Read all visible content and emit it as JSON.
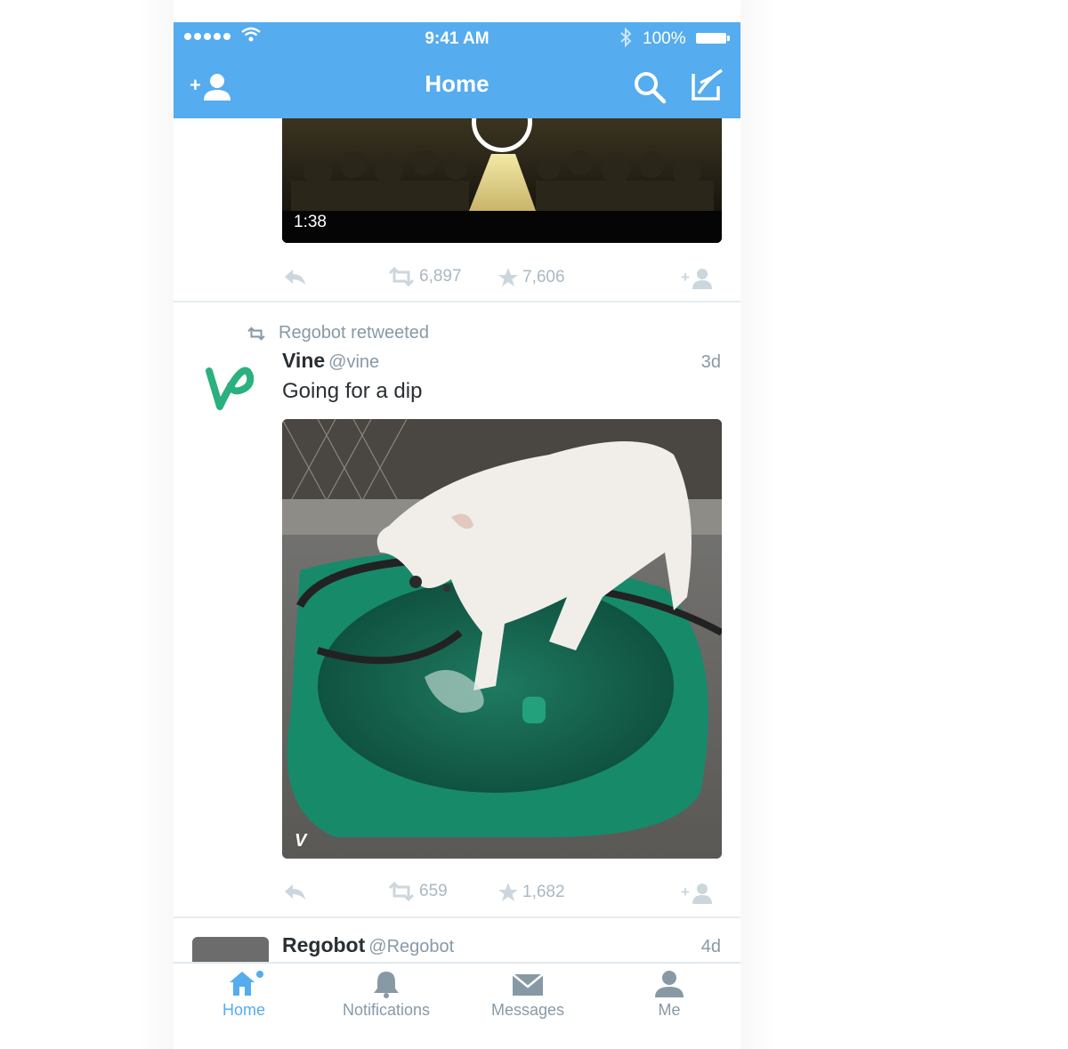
{
  "status_bar": {
    "time": "9:41 AM",
    "battery": "100%"
  },
  "header": {
    "title": "Home"
  },
  "video_tweet": {
    "duration": "1:38",
    "retweets": "6,897",
    "favorites": "7,606"
  },
  "tweet": {
    "retweeted_by": "Regobot retweeted",
    "author_name": "Vine",
    "author_handle": "@vine",
    "timestamp": "3d",
    "text": "Going for a dip",
    "retweets": "659",
    "favorites": "1,682"
  },
  "next_tweet": {
    "author_name": "Regobot",
    "author_handle": "@Regobot",
    "timestamp": "4d"
  },
  "tabs": [
    {
      "label": "Home",
      "icon": "home-icon",
      "active": true
    },
    {
      "label": "Notifications",
      "icon": "bell-icon",
      "active": false
    },
    {
      "label": "Messages",
      "icon": "envelope-icon",
      "active": false
    },
    {
      "label": "Me",
      "icon": "person-icon",
      "active": false
    }
  ],
  "colors": {
    "brand": "#55acee",
    "muted": "#8899a6",
    "vine_green": "#2bb07f"
  }
}
